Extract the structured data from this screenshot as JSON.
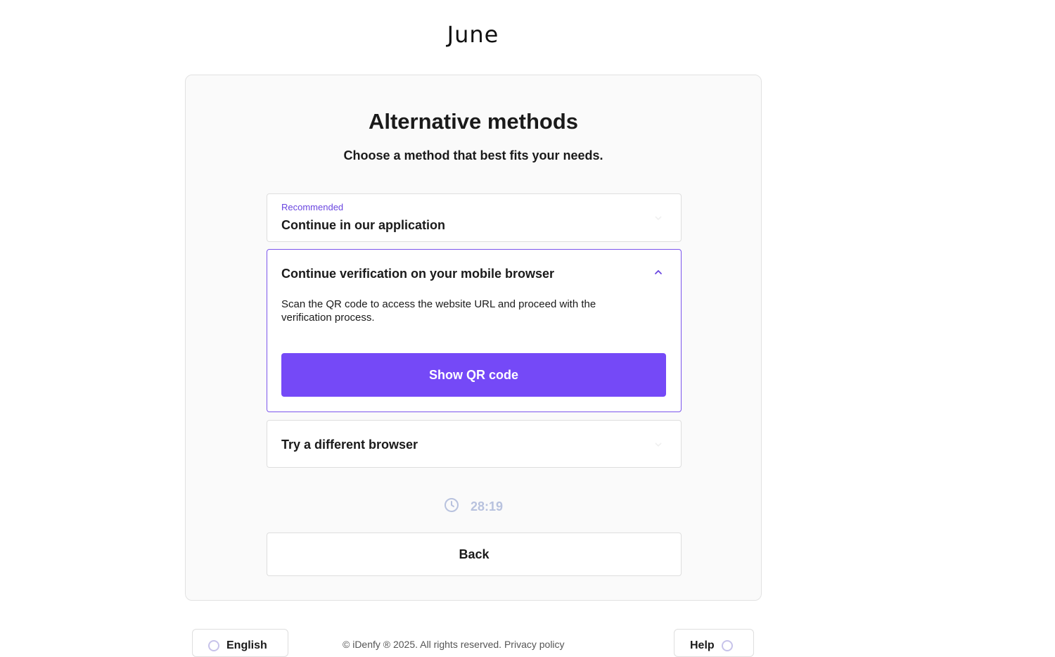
{
  "brand": {
    "logo_text": "June"
  },
  "card": {
    "title": "Alternative methods",
    "subtitle": "Choose a method that best fits your needs."
  },
  "options": {
    "app": {
      "badge": "Recommended",
      "title": "Continue in our application",
      "expanded": false
    },
    "mobile": {
      "title": "Continue verification on your mobile browser",
      "description": "Scan the QR code to access the website URL and proceed with the verification process.",
      "button_label": "Show QR code",
      "expanded": true
    },
    "browser": {
      "title": "Try a different browser",
      "expanded": false
    }
  },
  "timer": {
    "value": "28:19",
    "icon": "clock-icon"
  },
  "back_label": "Back",
  "footer": {
    "language_label": "English",
    "copyright": "© iDenfy ® 2025. All rights reserved. Privacy policy",
    "help_label": "Help"
  },
  "colors": {
    "accent": "#7549f7",
    "accent_border": "#7b55ec",
    "recommended_text": "#6a46e0",
    "timer_text": "#b8c2de"
  }
}
